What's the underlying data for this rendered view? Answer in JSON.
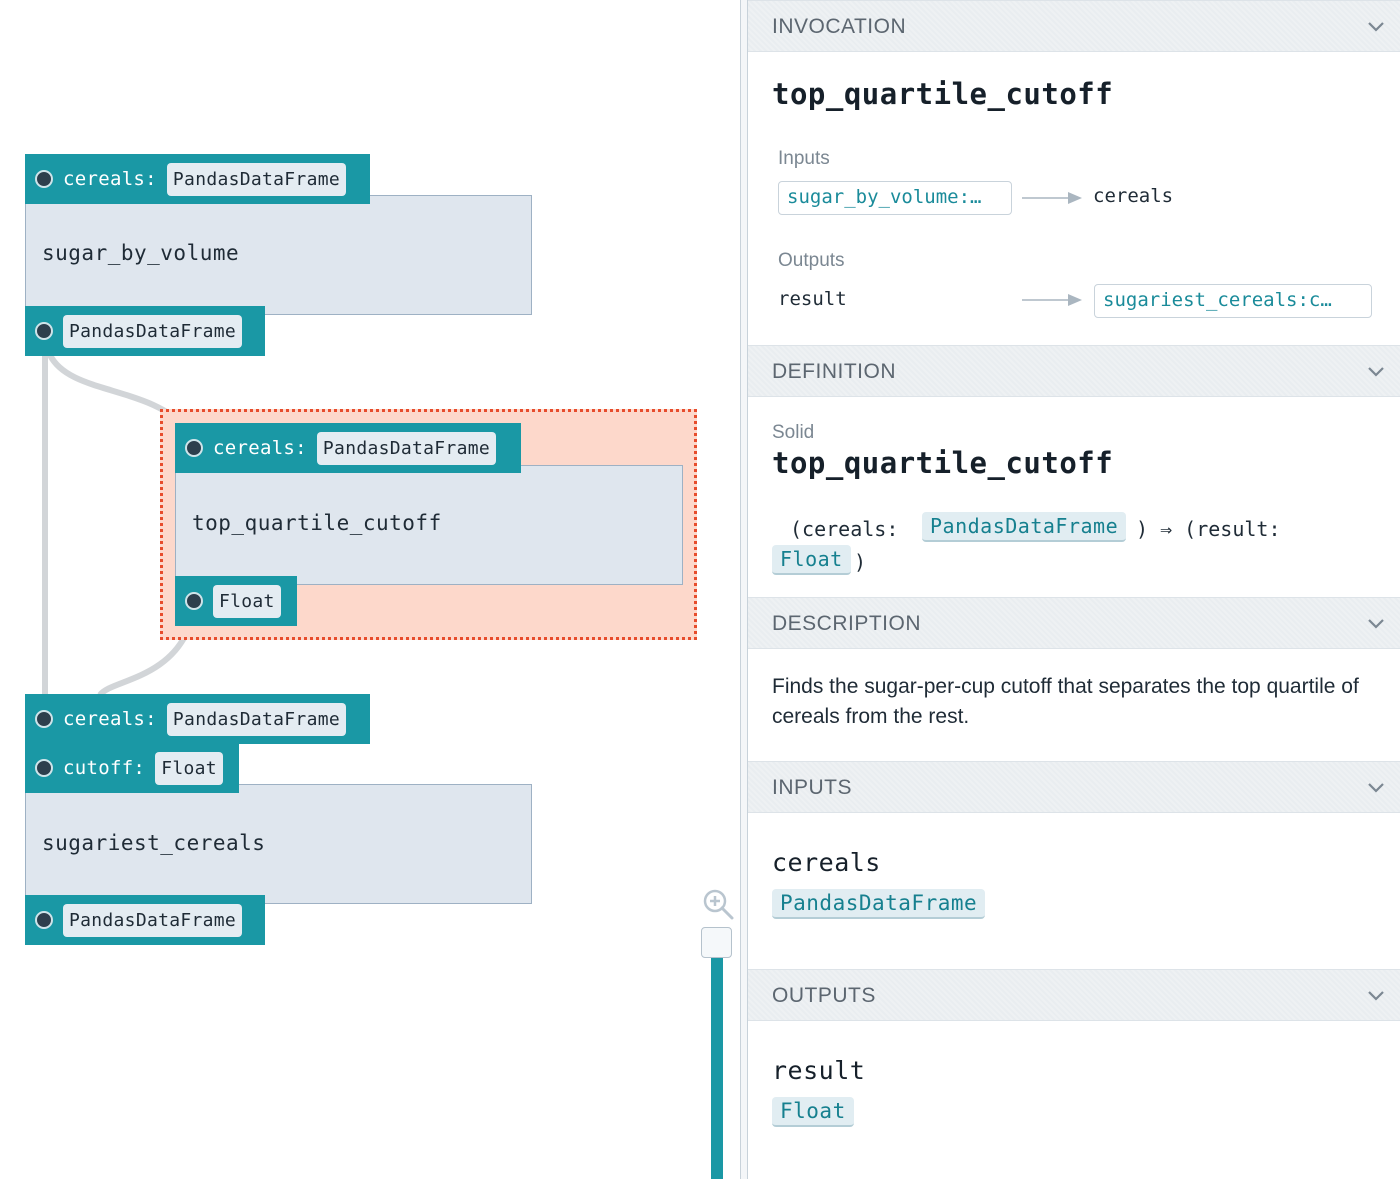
{
  "graph": {
    "solids": [
      {
        "name": "sugar_by_volume",
        "inputs": [
          {
            "name": "cereals:",
            "type": "PandasDataFrame"
          }
        ],
        "output": {
          "type": "PandasDataFrame"
        }
      },
      {
        "name": "top_quartile_cutoff",
        "selected": true,
        "inputs": [
          {
            "name": "cereals:",
            "type": "PandasDataFrame"
          }
        ],
        "output": {
          "type": "Float"
        }
      },
      {
        "name": "sugariest_cereals",
        "inputs": [
          {
            "name": "cereals:",
            "type": "PandasDataFrame"
          },
          {
            "name": "cutoff:",
            "type": "Float"
          }
        ],
        "output": {
          "type": "PandasDataFrame"
        }
      }
    ],
    "colors": {
      "port": "#1a98a5",
      "solid_bg": "#dfe6ee",
      "selection": "#e74c2c",
      "selection_bg": "#fdd8cb"
    }
  },
  "panel": {
    "invocation": {
      "header": "INVOCATION",
      "name": "top_quartile_cutoff",
      "inputs_label": "Inputs",
      "input_source": "sugar_by_volume:…",
      "input_target": "cereals",
      "outputs_label": "Outputs",
      "output_source": "result",
      "output_target": "sugariest_cereals:c…"
    },
    "definition": {
      "header": "DEFINITION",
      "kind": "Solid",
      "name": "top_quartile_cutoff",
      "sig_open": "(cereals:",
      "sig_input_type": "PandasDataFrame",
      "sig_mid": ") ⇒ (result:",
      "sig_output_type": "Float",
      "sig_close": ")"
    },
    "description": {
      "header": "DESCRIPTION",
      "text": "Finds the sugar-per-cup cutoff that separates the top quartile of cereals from the rest."
    },
    "inputs": {
      "header": "INPUTS",
      "name": "cereals",
      "type": "PandasDataFrame"
    },
    "outputs": {
      "header": "OUTPUTS",
      "name": "result",
      "type": "Float"
    }
  },
  "icons": [
    "zoom-in-icon",
    "chevron-down-icon",
    "port-dot-icon",
    "arrow-right-icon"
  ]
}
